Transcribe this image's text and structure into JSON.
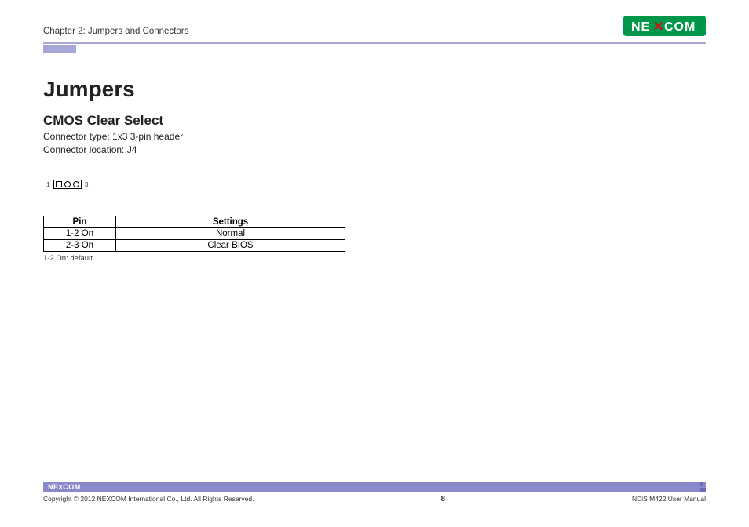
{
  "header": {
    "chapter": "Chapter 2: Jumpers and Connectors",
    "brand": "NEXCOM"
  },
  "content": {
    "title": "Jumpers",
    "section": "CMOS Clear Select",
    "connector_type": "Connector type: 1x3 3-pin header",
    "connector_location": "Connector location: J4",
    "diagram": {
      "left": "1",
      "right": "3"
    },
    "table": {
      "head": {
        "pin": "Pin",
        "settings": "Settings"
      },
      "rows": [
        {
          "pin": "1-2 On",
          "settings": "Normal"
        },
        {
          "pin": "2-3 On",
          "settings": "Clear BIOS"
        }
      ]
    },
    "note": "1-2 On: default"
  },
  "footer": {
    "brand": "NE×COM",
    "copyright": "Copyright © 2012 NEXCOM International Co., Ltd. All Rights Reserved.",
    "page": "8",
    "manual": "NDiS M422 User Manual"
  }
}
